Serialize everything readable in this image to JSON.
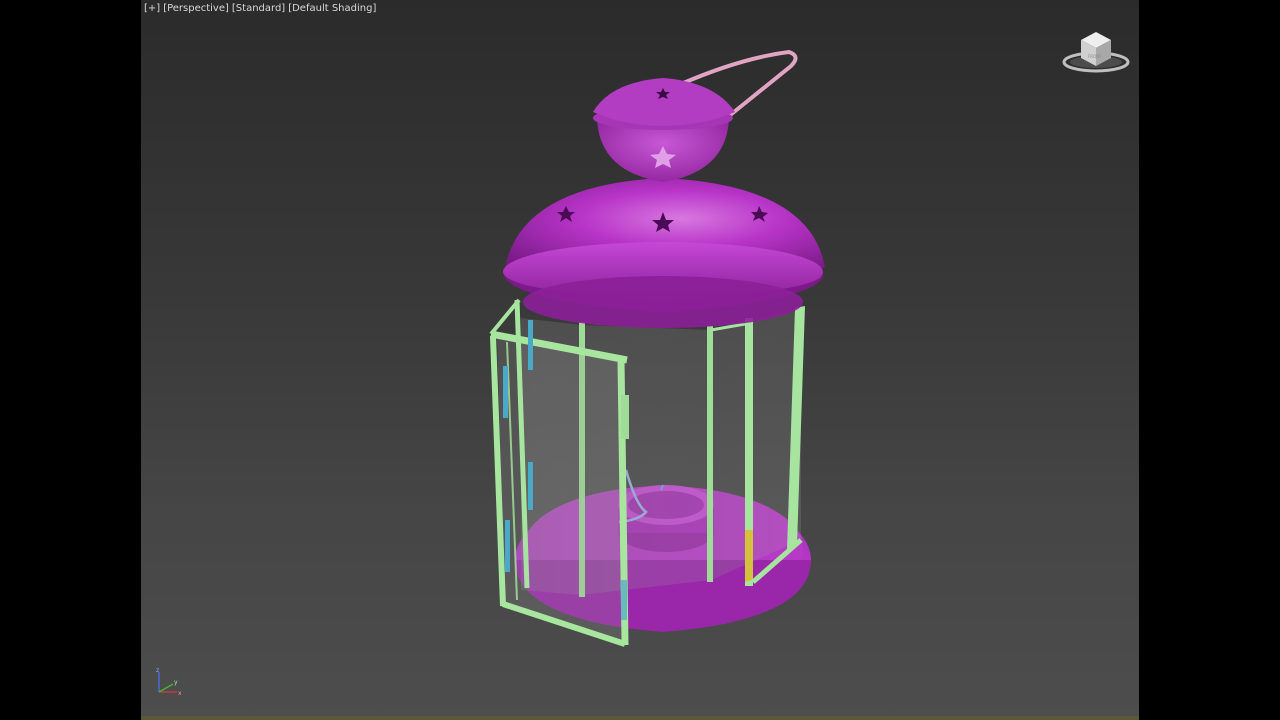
{
  "viewport": {
    "menu_label": "[+]",
    "view_label": "[Perspective]",
    "renderer_label": "[Standard]",
    "shading_label": "[Default Shading]"
  },
  "viewcube": {
    "face_label": "FRONT"
  },
  "axis": {
    "x_label": "x",
    "y_label": "y",
    "z_label": "z"
  },
  "colors": {
    "lantern_body": "#b030c0",
    "frame": "#a8e6a0",
    "handle": "#e8a8c8",
    "hinge": "#4aa8c8",
    "background_top": "#2b2b2b",
    "background_bottom": "#4d4d4d"
  }
}
